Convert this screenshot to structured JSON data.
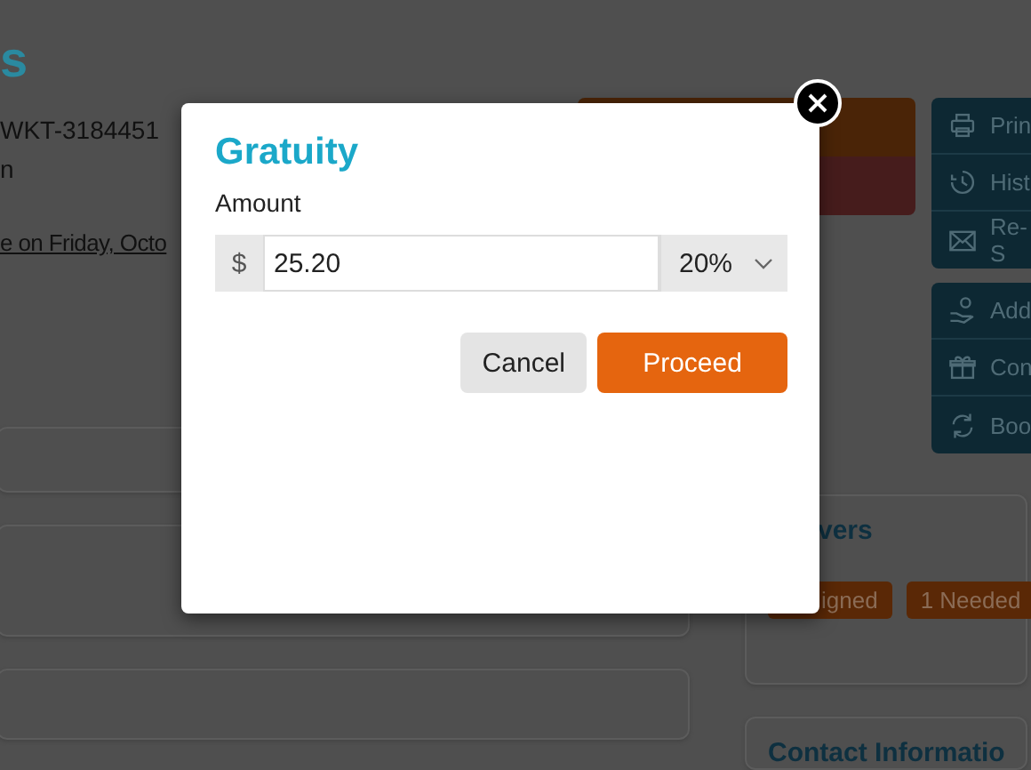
{
  "page": {
    "heading": "s",
    "order_number": "WKT-3184451",
    "detail": "n",
    "event_link": "e on Friday, Octo",
    "action_buttons": [
      {
        "color": "#4a2407"
      },
      {
        "color": "#461c1c"
      }
    ],
    "side_menus": [
      [
        {
          "label": "Prin"
        },
        {
          "label": "Hist"
        },
        {
          "label": "Re-S"
        }
      ],
      [
        {
          "label": "Add"
        },
        {
          "label": "Con"
        },
        {
          "label": "Boo"
        }
      ]
    ],
    "waivers": {
      "title": "vers",
      "badges": [
        "igned",
        "1 Needed"
      ]
    },
    "contact": {
      "title": "Contact Informatio"
    }
  },
  "dialog": {
    "title": "Gratuity",
    "field_label": "Amount",
    "currency": "$",
    "value": "25.20",
    "percent": "20%",
    "buttons": [
      {
        "label": "Cancel",
        "kind": "secondary"
      },
      {
        "label": "Proceed",
        "kind": "primary"
      }
    ]
  }
}
